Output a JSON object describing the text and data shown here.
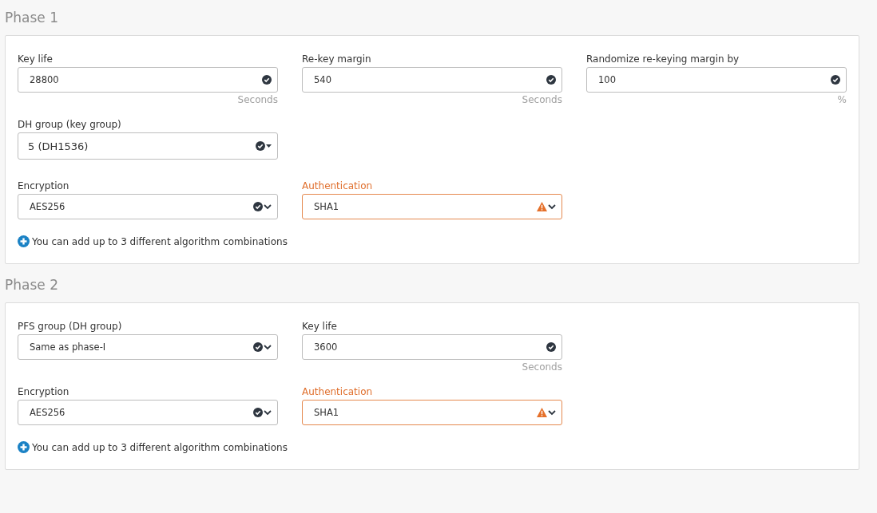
{
  "sections": [
    {
      "title": "Phase 1",
      "rows": [
        [
          {
            "kind": "input",
            "label": "Key life",
            "value": "28800",
            "unit": "Seconds",
            "warning": false
          },
          {
            "kind": "input",
            "label": "Re-key margin",
            "value": "540",
            "unit": "Seconds",
            "warning": false
          },
          {
            "kind": "input",
            "label": "Randomize re-keying margin by",
            "value": "100",
            "unit": "%",
            "warning": false
          }
        ],
        [
          {
            "kind": "picker",
            "label": "DH group (key group)",
            "value": "5 (DH1536)",
            "warning": false
          }
        ],
        [
          {
            "kind": "select",
            "label": "Encryption",
            "value": "AES256",
            "warning": false
          },
          {
            "kind": "select",
            "label": "Authentication",
            "value": "SHA1",
            "warning": true
          }
        ]
      ],
      "add_link": "You can add up to 3 different algorithm combinations"
    },
    {
      "title": "Phase 2",
      "rows": [
        [
          {
            "kind": "select",
            "label": "PFS group (DH group)",
            "value": "Same as phase-I",
            "warning": false
          },
          {
            "kind": "input",
            "label": "Key life",
            "value": "3600",
            "unit": "Seconds",
            "warning": false
          }
        ],
        [
          {
            "kind": "select",
            "label": "Encryption",
            "value": "AES256",
            "warning": false
          },
          {
            "kind": "select",
            "label": "Authentication",
            "value": "SHA1",
            "warning": true
          }
        ]
      ],
      "add_link": "You can add up to 3 different algorithm combinations"
    }
  ]
}
